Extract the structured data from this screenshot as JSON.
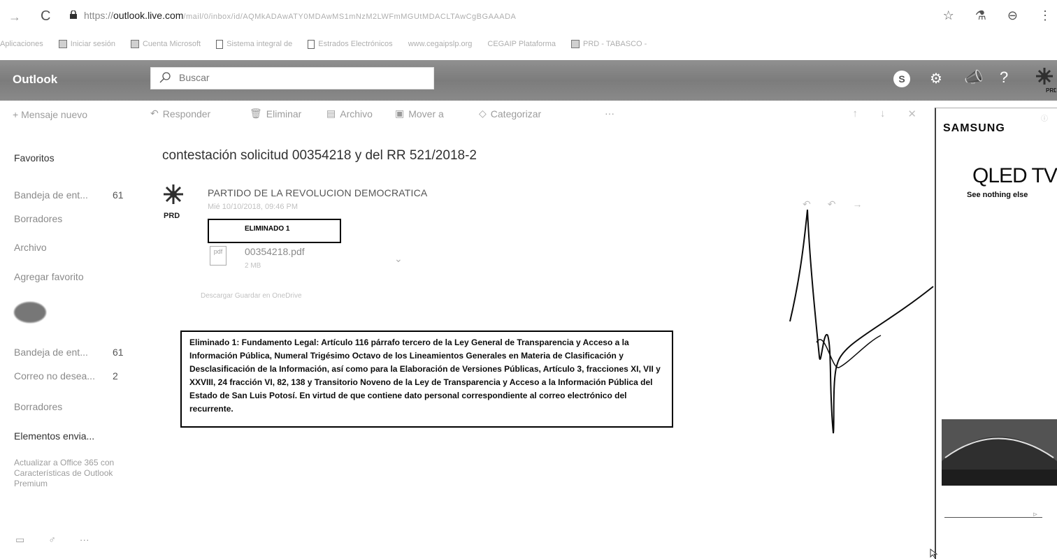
{
  "browser": {
    "url_host_prefix": "https://",
    "url_host": "outlook.live.com",
    "url_rest": "/mail/0/inbox/id/AQMkADAwATY0MDAwMS1mNzM2LWFmMGUtMDACLTAwCgBGAAADA",
    "bookmarks": [
      {
        "label": "Aplicaciones",
        "icon": "apps-icon"
      },
      {
        "label": "Iniciar sesión",
        "icon": "grid-icon"
      },
      {
        "label": "Cuenta Microsoft",
        "icon": "grid-icon"
      },
      {
        "label": "Sistema integral de",
        "icon": "document-icon"
      },
      {
        "label": "Estrados Electrónicos",
        "icon": "document-icon"
      },
      {
        "label": "www.cegaipslp.org",
        "icon": ""
      },
      {
        "label": "CEGAIP Plataforma",
        "icon": ""
      },
      {
        "label": "PRD - TABASCO -",
        "icon": "prd-icon"
      }
    ]
  },
  "header": {
    "brand": "Outlook",
    "search_placeholder": "Buscar",
    "skype_letter": "S",
    "avatar_text": "PRD"
  },
  "nav": {
    "new_message": "Mensaje nuevo",
    "favorites_title": "Favoritos",
    "favorites": [
      {
        "label": "Bandeja de ent...",
        "count": "61"
      },
      {
        "label": "Borradores",
        "count": ""
      },
      {
        "label": "Archivo",
        "count": ""
      },
      {
        "label": "Agregar favorito",
        "count": ""
      }
    ],
    "folders": [
      {
        "label": "Bandeja de ent...",
        "count": "61"
      },
      {
        "label": "Correo no desea...",
        "count": "2"
      },
      {
        "label": "Borradores",
        "count": ""
      },
      {
        "label": "Elementos envia...",
        "count": ""
      }
    ],
    "upgrade_text": "Actualizar a Office 365 con Características de Outlook Premium"
  },
  "toolbar": {
    "reply": "Responder",
    "delete": "Eliminar",
    "archive": "Archivo",
    "move": "Mover a",
    "categorize": "Categorizar",
    "more": "···"
  },
  "message": {
    "subject": "contestación solicitud 00354218 y del RR 521/2018-2",
    "sender": "PARTIDO DE LA REVOLUCION DEMOCRATICA",
    "date": "Mié 10/10/2018, 09:46 PM",
    "redaction_label": "ELIMINADO 1",
    "attachment_name": "00354218.pdf",
    "attachment_size": "2 MB",
    "attachment_type": "pdf",
    "links": "Descargar   Guardar en OneDrive",
    "legal_note": "Eliminado 1: Fundamento Legal: Artículo 116 párrafo tercero de la Ley General de Transparencia y Acceso a la Información Pública, Numeral Trigésimo Octavo de los Lineamientos Generales en Materia de Clasificación y Desclasificación de la Información, así como para la Elaboración de Versiones Públicas, Artículo 3, fracciones XI, VII y XXVIII, 24 fracción VI, 82, 138 y Transitorio Noveno de la Ley de Transparencia y Acceso a la Información Pública del Estado de San Luis Potosí. En virtud de que contiene dato personal correspondiente al correo electrónico del recurrente."
  },
  "ad": {
    "brand": "SAMSUNG",
    "product": "QLED TV",
    "tagline": "See nothing else"
  }
}
